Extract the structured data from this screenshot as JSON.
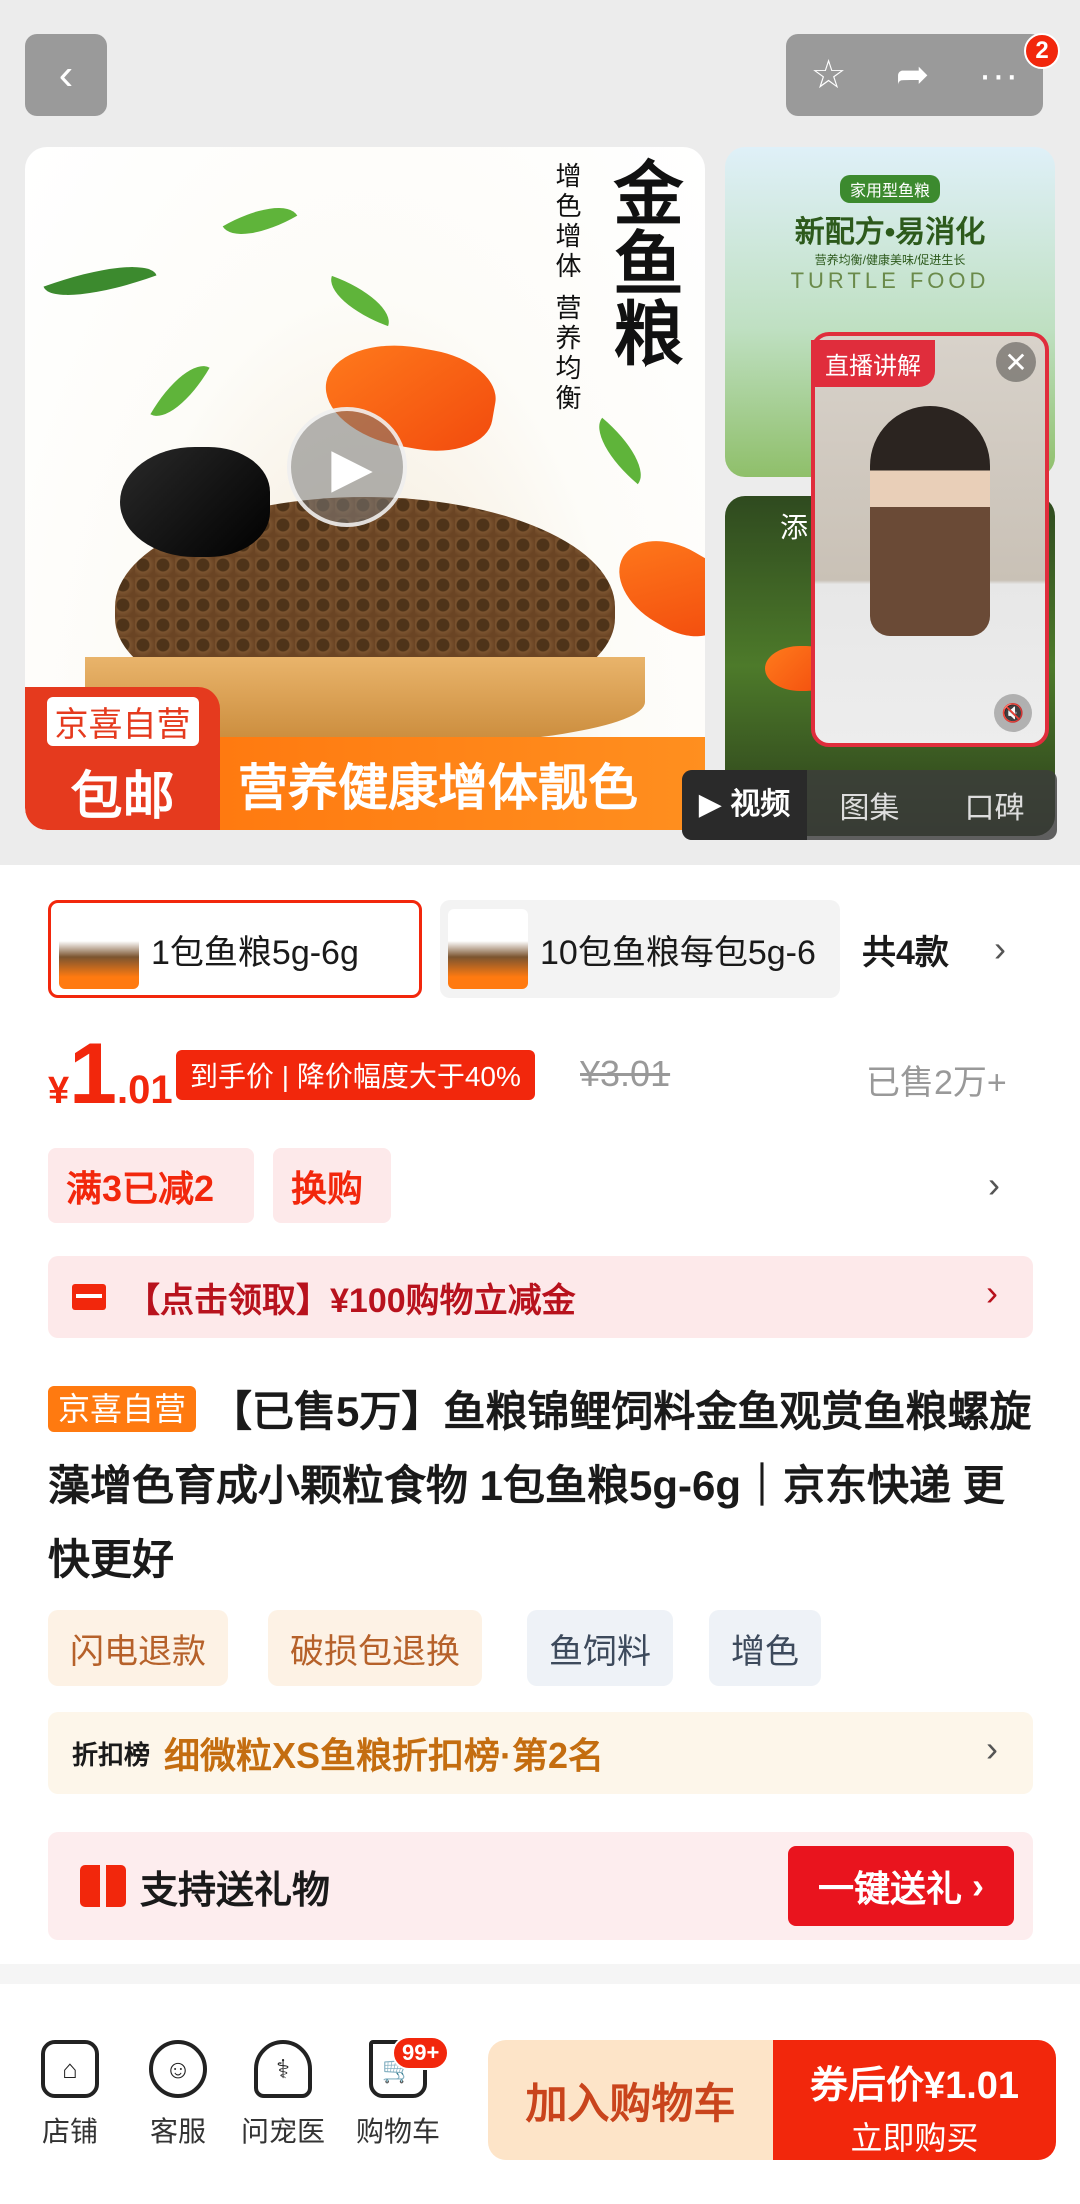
{
  "header": {
    "back_icon": "chevron-left-icon",
    "actions": [
      "star-icon",
      "share-icon",
      "more-icon"
    ],
    "notif_count": "2"
  },
  "hero": {
    "vertical_title": "金鱼粮",
    "vertical_slogan": "增色增体 营养均衡",
    "jx_line1": "京喜自营",
    "jx_line2": "包邮",
    "banner": "营养健康增体靓色",
    "thumb1": {
      "tag": "家用型鱼粮",
      "headline": "新配方•易消化",
      "sub": "营养均衡/健康美味/促进生长",
      "en": "TURTLE FOOD"
    },
    "thumb2_text": "添",
    "live_tag": "直播讲解",
    "media_tabs": [
      "视频",
      "图集",
      "口碑"
    ]
  },
  "sku": {
    "options": [
      "1包鱼粮5g-6g",
      "10包鱼粮每包5g-6"
    ],
    "count": "共4款"
  },
  "price": {
    "currency": "¥",
    "integer": "1",
    "decimal": ".01",
    "tag": "到手价 | 降价幅度大于40%",
    "original": "¥3.01",
    "sold": "已售2万+"
  },
  "promos": [
    "满3已减2",
    "换购"
  ],
  "coupon": "【点击领取】¥100购物立减金",
  "title": {
    "badge": "京喜自营",
    "text": "【已售5万】鱼粮锦鲤饲料金鱼观赏鱼粮螺旋藻增色育成小颗粒食物 1包鱼粮5g-6g｜京东快递 更快更好"
  },
  "chips": [
    "闪电退款",
    "破损包退换",
    "鱼饲料",
    "增色"
  ],
  "rank": {
    "key": "折扣榜",
    "value": "细微粒XS鱼粮折扣榜·第2名"
  },
  "gift": {
    "label": "支持送礼物",
    "button": "一键送礼"
  },
  "bottom_nav": {
    "items": [
      "店铺",
      "客服",
      "问宠医",
      "购物车"
    ],
    "cart_badge": "99+",
    "add_cart": "加入购物车",
    "buy_line1": "券后价¥1.01",
    "buy_line2": "立即购买"
  },
  "colors": {
    "accent": "#f2270c",
    "orange": "#ff7a10",
    "rank_gold": "#c46d10"
  }
}
